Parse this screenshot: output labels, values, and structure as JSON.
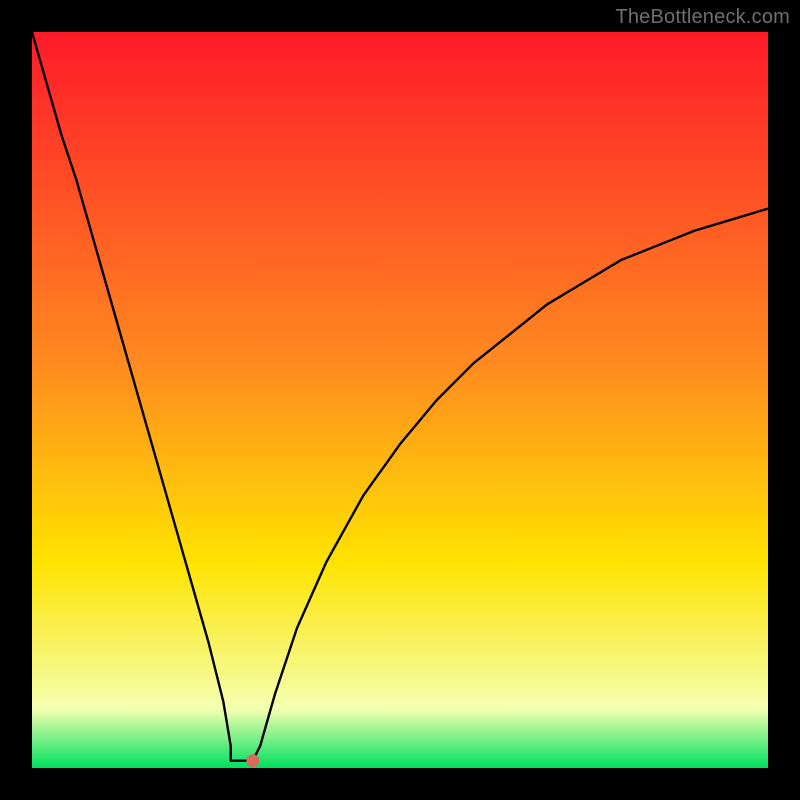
{
  "watermark": "TheBottleneck.com",
  "colors": {
    "frame": "#000000",
    "curve": "#000000",
    "marker": "#d86a5d",
    "green": "#00e060",
    "pale": "#f4ffb0",
    "yellow": "#ffe300",
    "orange": "#ff8a1f",
    "red": "#ff1a2a"
  },
  "chart_data": {
    "type": "line",
    "title": "",
    "xlabel": "",
    "ylabel": "",
    "xlim": [
      0,
      100
    ],
    "ylim": [
      0,
      100
    ],
    "x": [
      0,
      2,
      4,
      6,
      8,
      10,
      12,
      14,
      16,
      18,
      20,
      22,
      24,
      26,
      27,
      28,
      30,
      31,
      33,
      36,
      40,
      45,
      50,
      55,
      60,
      65,
      70,
      75,
      80,
      85,
      90,
      95,
      100
    ],
    "values": [
      100,
      93,
      86,
      80,
      73,
      66,
      59,
      52,
      45,
      38,
      31,
      24,
      17,
      9,
      3,
      1,
      1,
      3,
      10,
      19,
      28,
      37,
      44,
      50,
      55,
      59,
      63,
      66,
      69,
      71,
      73,
      74.5,
      76
    ],
    "marker": {
      "x": 30,
      "y": 1
    },
    "plateau": {
      "x0": 27,
      "x1": 30,
      "y": 1
    },
    "annotations": []
  }
}
